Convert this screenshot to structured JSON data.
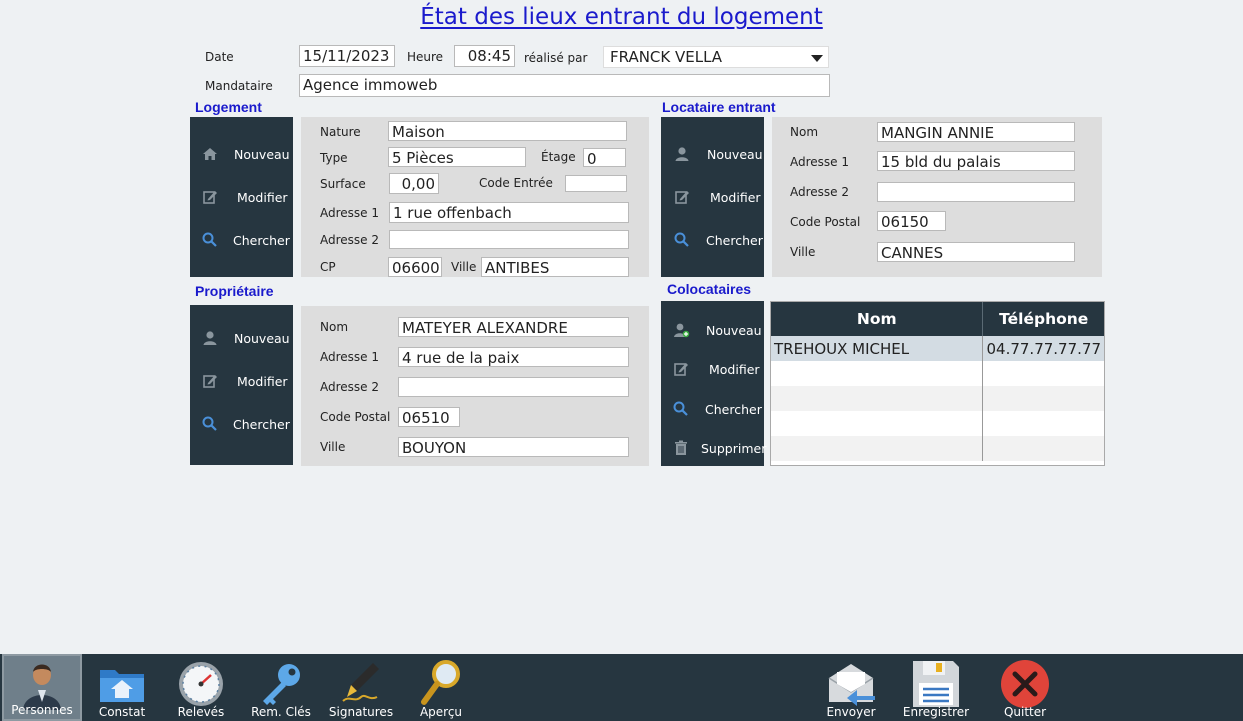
{
  "title": "État des lieux entrant du logement",
  "header": {
    "date_label": "Date",
    "date_value": "15/11/2023",
    "heure_label": "Heure",
    "heure_value": "08:45",
    "realise_label": "réalisé par",
    "realise_value": "FRANCK VELLA",
    "mandataire_label": "Mandataire",
    "mandataire_value": "Agence immoweb"
  },
  "logement": {
    "section_title": "Logement",
    "buttons": {
      "new": "Nouveau",
      "edit": "Modifier",
      "search": "Chercher"
    },
    "nature_label": "Nature",
    "nature_value": "Maison",
    "type_label": "Type",
    "type_value": "5 Pièces",
    "etage_label": "Étage",
    "etage_value": "0",
    "surface_label": "Surface",
    "surface_value": "0,00",
    "code_label": "Code Entrée",
    "code_value": "",
    "adresse1_label": "Adresse 1",
    "adresse1_value": "1 rue offenbach",
    "adresse2_label": "Adresse 2",
    "adresse2_value": "",
    "cp_label": "CP",
    "cp_value": "06600",
    "ville_label": "Ville",
    "ville_value": "ANTIBES"
  },
  "locataire": {
    "section_title": "Locataire entrant",
    "buttons": {
      "new": "Nouveau",
      "edit": "Modifier",
      "search": "Chercher"
    },
    "nom_label": "Nom",
    "nom_value": "MANGIN ANNIE",
    "adresse1_label": "Adresse 1",
    "adresse1_value": "15 bld du palais",
    "adresse2_label": "Adresse 2",
    "adresse2_value": "",
    "cp_label": "Code Postal",
    "cp_value": "06150",
    "ville_label": "Ville",
    "ville_value": "CANNES"
  },
  "proprietaire": {
    "section_title": "Propriétaire",
    "buttons": {
      "new": "Nouveau",
      "edit": "Modifier",
      "search": "Chercher"
    },
    "nom_label": "Nom",
    "nom_value": "MATEYER ALEXANDRE",
    "adresse1_label": "Adresse 1",
    "adresse1_value": "4 rue de la paix",
    "adresse2_label": "Adresse 2",
    "adresse2_value": "",
    "cp_label": "Code Postal",
    "cp_value": "06510",
    "ville_label": "Ville",
    "ville_value": "BOUYON"
  },
  "colocataires": {
    "section_title": "Colocataires",
    "buttons": {
      "new": "Nouveau",
      "edit": "Modifier",
      "search": "Chercher",
      "delete": "Supprimer"
    },
    "columns": [
      "Nom",
      "Téléphone"
    ],
    "rows": [
      {
        "nom": "TREHOUX MICHEL",
        "tel": "04.77.77.77.77"
      }
    ]
  },
  "bottom_nav": {
    "items": [
      {
        "label": "Personnes",
        "icon": "person-icon"
      },
      {
        "label": "Constat",
        "icon": "folder-home-icon"
      },
      {
        "label": "Relevés",
        "icon": "gauge-icon"
      },
      {
        "label": "Rem. Clés",
        "icon": "key-icon"
      },
      {
        "label": "Signatures",
        "icon": "pen-icon"
      },
      {
        "label": "Aperçu",
        "icon": "magnifier-icon"
      },
      {
        "label": "Envoyer",
        "icon": "mail-send-icon"
      },
      {
        "label": "Enregistrer",
        "icon": "floppy-icon"
      },
      {
        "label": "Quitter",
        "icon": "close-icon"
      }
    ]
  },
  "colors": {
    "toolbar": "#263640",
    "section_title": "#1a1acc",
    "panel": "#dddddd",
    "quit_red": "#e0443a"
  }
}
